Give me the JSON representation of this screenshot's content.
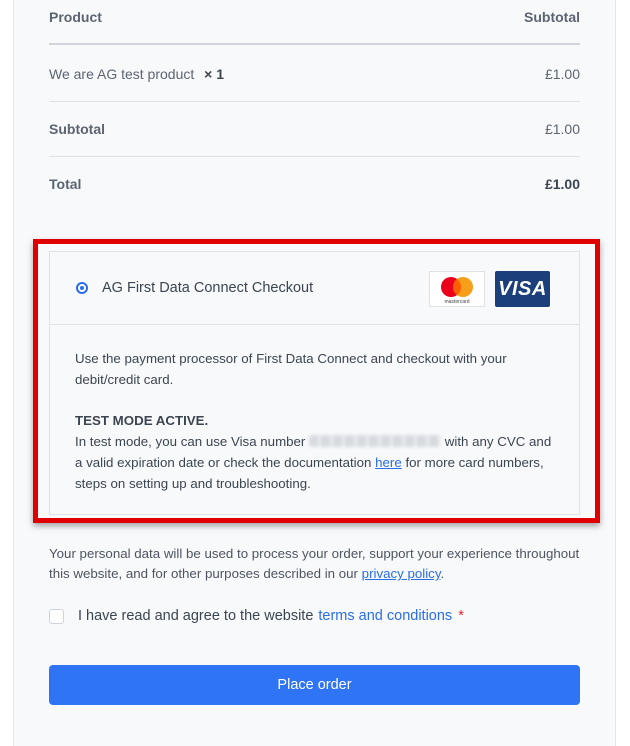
{
  "order": {
    "header_product": "Product",
    "header_subtotal": "Subtotal",
    "item_name": "We are AG test product",
    "item_qty": "× 1",
    "item_price": "£1.00",
    "subtotal_label": "Subtotal",
    "subtotal_value": "£1.00",
    "total_label": "Total",
    "total_value": "£1.00"
  },
  "payment": {
    "gateway_title": "AG First Data Connect Checkout",
    "mastercard_text": "mastercard",
    "visa_text": "VISA",
    "description": "Use the payment processor of First Data Connect and checkout with your debit/credit card.",
    "test_mode_title": "TEST MODE ACTIVE.",
    "test_mode_part1": "In test mode, you can use Visa number",
    "test_mode_part2": "with any CVC and a valid expiration date or check the documentation",
    "doc_link": "here",
    "test_mode_part3": "for more card numbers, steps on setting up and troubleshooting."
  },
  "privacy": {
    "text": "Your personal data will be used to process your order, support your experience throughout this website, and for other purposes described in our",
    "link": "privacy policy",
    "end": "."
  },
  "terms": {
    "text": "I have read and agree to the website",
    "link": "terms and conditions",
    "required": "*"
  },
  "place_order_label": "Place order",
  "colors": {
    "accent": "#2f74f5",
    "highlight": "#e00000",
    "visa_bg": "#1a3f7a"
  },
  "icons": {
    "radio": "radio-selected-icon",
    "mastercard": "mastercard-logo-icon",
    "visa": "visa-logo-icon"
  }
}
